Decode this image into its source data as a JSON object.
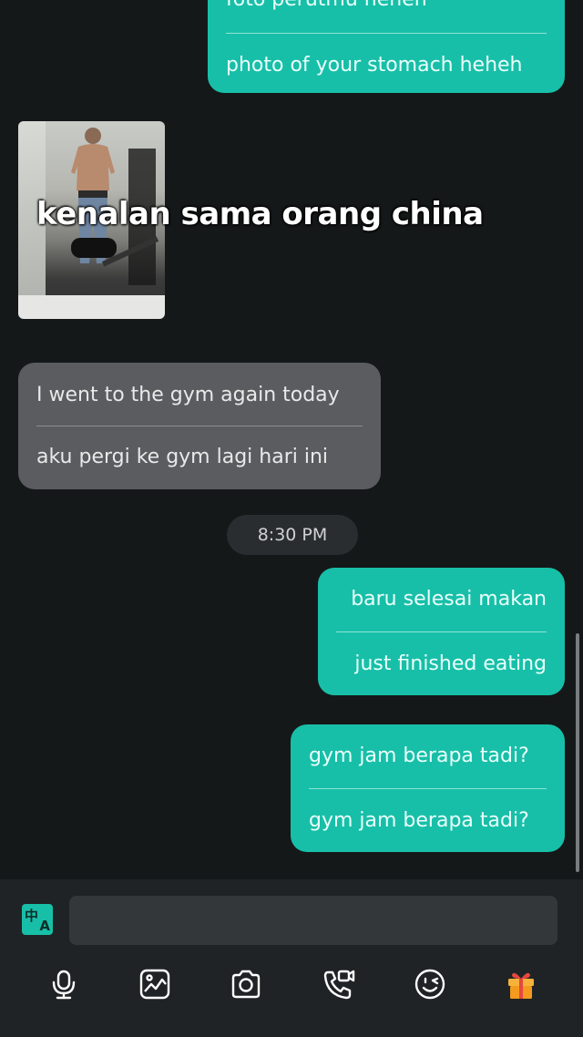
{
  "messages": [
    {
      "direction": "outgoing",
      "original": "foto perutmu heheh",
      "translation": "photo of your stomach heheh"
    },
    {
      "direction": "incoming",
      "type": "image",
      "alt": "gym selfie photo"
    },
    {
      "direction": "incoming",
      "original": "I went to the gym again today",
      "translation": "aku pergi ke gym lagi hari ini"
    },
    {
      "direction": "outgoing",
      "original": "baru selesai makan",
      "translation": "just finished eating"
    },
    {
      "direction": "outgoing",
      "original": "gym jam berapa tadi?",
      "translation": "gym jam berapa tadi?"
    }
  ],
  "timestamp": "8:30 PM",
  "overlay_caption": "kenalan sama orang china",
  "composer": {
    "placeholder": "",
    "value": "",
    "translate_icon": {
      "top": "中",
      "bottom": "A"
    }
  },
  "toolbar": {
    "icons": [
      "microphone-icon",
      "gallery-icon",
      "camera-icon",
      "video-call-icon",
      "emoji-icon",
      "gift-icon"
    ]
  },
  "colors": {
    "accent": "#18bfa8",
    "background": "#151819",
    "incoming_bubble": "#5a5c5f",
    "gift": "#f5a623"
  }
}
